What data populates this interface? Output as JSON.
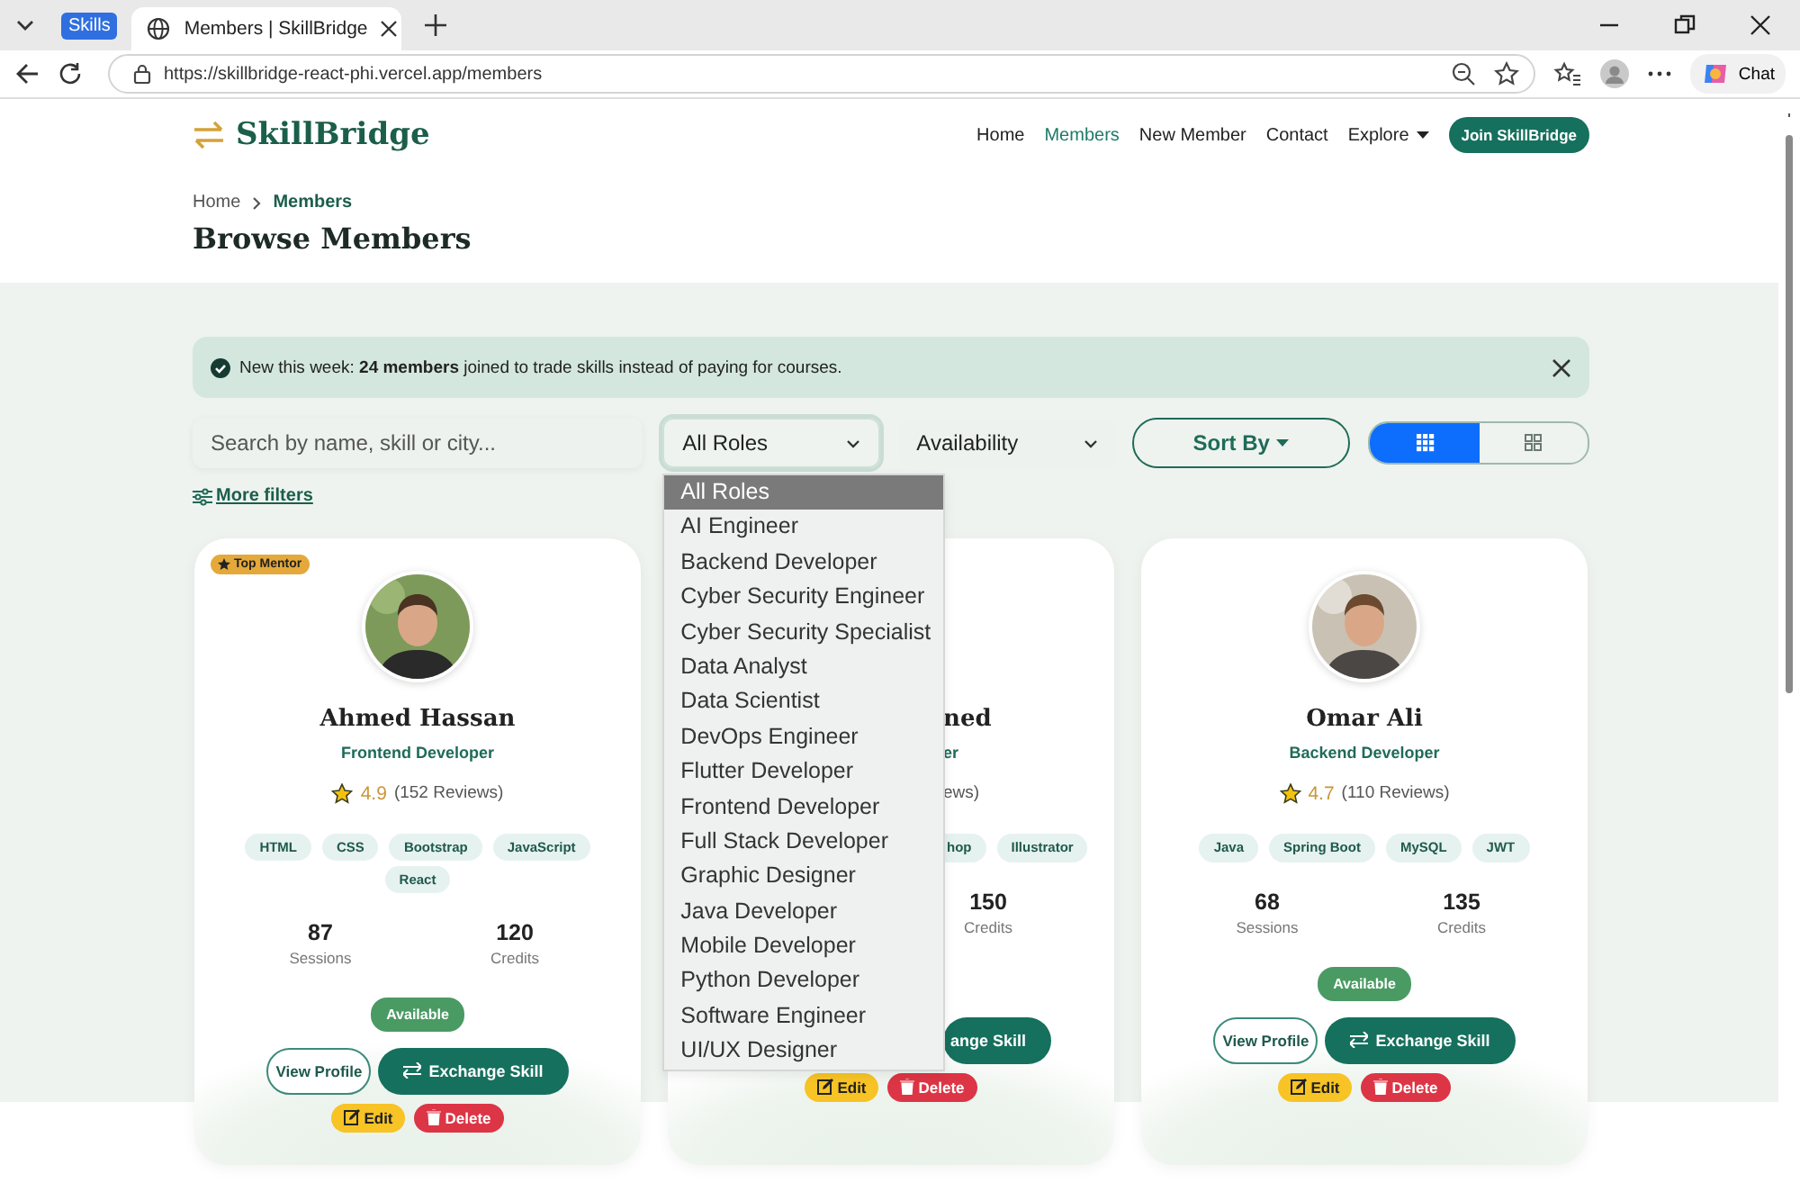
{
  "browser": {
    "tab_group": "Skills",
    "tab_title": "Members | SkillBridge",
    "url": "https://skillbridge-react-phi.vercel.app/members",
    "chat": "Chat"
  },
  "nav": {
    "brand": "SkillBridge",
    "links": [
      {
        "label": "Home",
        "kind": "link",
        "selected": false
      },
      {
        "label": "Members",
        "kind": "link",
        "selected": true
      },
      {
        "label": "New Member",
        "kind": "link",
        "selected": false
      },
      {
        "label": "Contact",
        "kind": "link",
        "selected": false
      },
      {
        "label": "Explore",
        "kind": "dropdown",
        "selected": false
      }
    ],
    "cta": "Join SkillBridge"
  },
  "breadcrumb": [
    {
      "label": "Home",
      "current": false
    },
    {
      "label": "Members",
      "current": true
    }
  ],
  "heading": "Browse Members",
  "alert": {
    "text": "New this week: **24 members** joined to trade skills instead of paying for courses."
  },
  "filters": {
    "search_placeholder": "Search by name, skill or city...",
    "role": {
      "value": "All Roles",
      "expanded": true
    },
    "availability": {
      "value": "Availability"
    },
    "sort": "Sort By",
    "view_modes": [
      {
        "kind": "dense",
        "selected": true
      },
      {
        "kind": "grid",
        "selected": false
      }
    ],
    "more_filters": "More filters"
  },
  "role_menu": [
    {
      "label": "All Roles",
      "selected": true
    },
    {
      "label": "AI Engineer",
      "selected": false
    },
    {
      "label": "Backend Developer",
      "selected": false
    },
    {
      "label": "Cyber Security Engineer",
      "selected": false
    },
    {
      "label": "Cyber Security Specialist",
      "selected": false
    },
    {
      "label": "Data Analyst",
      "selected": false
    },
    {
      "label": "Data Scientist",
      "selected": false
    },
    {
      "label": "DevOps Engineer",
      "selected": false
    },
    {
      "label": "Flutter Developer",
      "selected": false
    },
    {
      "label": "Frontend Developer",
      "selected": false
    },
    {
      "label": "Full Stack Developer",
      "selected": false
    },
    {
      "label": "Graphic Designer",
      "selected": false
    },
    {
      "label": "Java Developer",
      "selected": false
    },
    {
      "label": "Mobile Developer",
      "selected": false
    },
    {
      "label": "Python Developer",
      "selected": false
    },
    {
      "label": "Software Engineer",
      "selected": false
    },
    {
      "label": "UI/UX Designer",
      "selected": false
    }
  ],
  "members": [
    {
      "kind": "full",
      "badge": "Top Mentor",
      "name": "Ahmed Hassan",
      "role": "Frontend Developer",
      "rating": "4.9",
      "reviews": "(152 Reviews)",
      "skills": [
        "HTML",
        "CSS",
        "Bootstrap",
        "JavaScript",
        "React"
      ],
      "sessions": "87",
      "sessions_label": "Sessions",
      "credits": "120",
      "credits_label": "Credits",
      "status": "Available",
      "actions": {
        "view": "View Profile",
        "exchange": "Exchange Skill",
        "edit": "Edit",
        "delete": "Delete"
      }
    },
    {
      "kind": "covered",
      "name": "ned",
      "role": "er",
      "reviews": "ews)",
      "skills": [
        "hop",
        "Illustrator"
      ],
      "credits": "150",
      "credits_label": "Credits",
      "actions": {
        "exchange": "ange Skill",
        "edit": "Edit",
        "delete": "Delete"
      }
    },
    {
      "kind": "full",
      "name": "Omar Ali",
      "role": "Backend Developer",
      "rating": "4.7",
      "reviews": "(110 Reviews)",
      "skills": [
        "Java",
        "Spring Boot",
        "MySQL",
        "JWT"
      ],
      "sessions": "68",
      "sessions_label": "Sessions",
      "credits": "135",
      "credits_label": "Credits",
      "status": "Available",
      "actions": {
        "view": "View Profile",
        "exchange": "Exchange Skill",
        "edit": "Edit",
        "delete": "Delete"
      }
    }
  ]
}
